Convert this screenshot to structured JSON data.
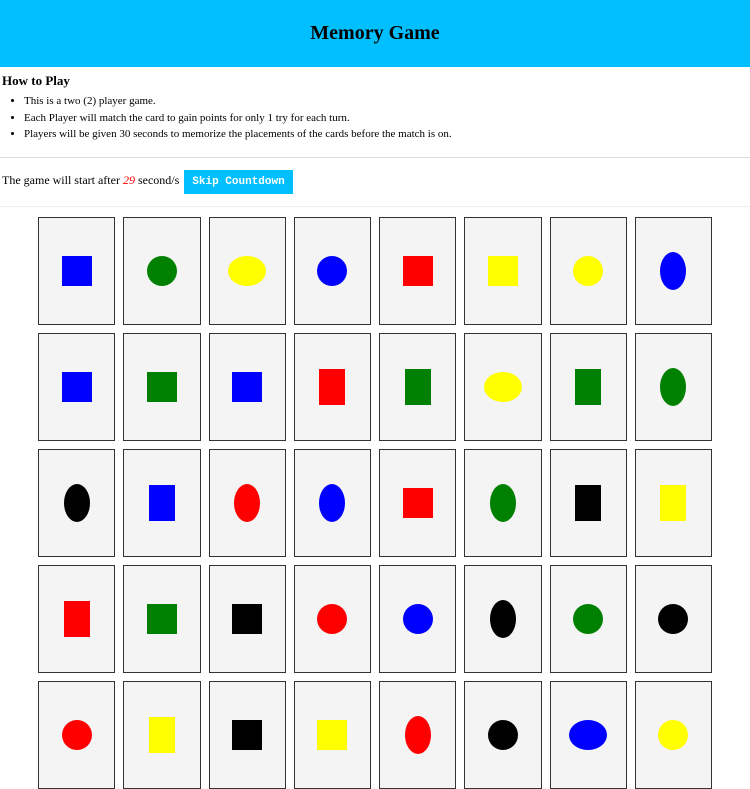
{
  "header": {
    "title": "Memory Game"
  },
  "howto": {
    "heading": "How to Play",
    "items": [
      "This is a two (2) player game.",
      "Each Player will match the card to gain points for only 1 try for each turn.",
      "Players will be given 30 seconds to memorize the placements of the cards before the match is on."
    ]
  },
  "countdown": {
    "prefix": "The game will start after ",
    "value": "29",
    "suffix": " second/s ",
    "skip_label": "Skip Countdown"
  },
  "colors": {
    "blue": "#0000ff",
    "green": "#008000",
    "yellow": "#ffff00",
    "red": "#ff0000",
    "black": "#000000"
  },
  "cards": [
    [
      {
        "shape": "square",
        "color": "blue"
      },
      {
        "shape": "circle",
        "color": "green"
      },
      {
        "shape": "ellipse-h",
        "color": "yellow"
      },
      {
        "shape": "circle",
        "color": "blue"
      },
      {
        "shape": "square",
        "color": "red"
      },
      {
        "shape": "square",
        "color": "yellow"
      },
      {
        "shape": "circle",
        "color": "yellow"
      },
      {
        "shape": "ellipse-v",
        "color": "blue"
      }
    ],
    [
      {
        "shape": "square",
        "color": "blue"
      },
      {
        "shape": "square",
        "color": "green"
      },
      {
        "shape": "square",
        "color": "blue"
      },
      {
        "shape": "rect-v",
        "color": "red"
      },
      {
        "shape": "rect-v",
        "color": "green"
      },
      {
        "shape": "ellipse-h",
        "color": "yellow"
      },
      {
        "shape": "rect-v",
        "color": "green"
      },
      {
        "shape": "ellipse-v",
        "color": "green"
      }
    ],
    [
      {
        "shape": "ellipse-v",
        "color": "black"
      },
      {
        "shape": "rect-v",
        "color": "blue"
      },
      {
        "shape": "ellipse-v",
        "color": "red"
      },
      {
        "shape": "ellipse-v",
        "color": "blue"
      },
      {
        "shape": "square",
        "color": "red"
      },
      {
        "shape": "ellipse-v",
        "color": "green"
      },
      {
        "shape": "rect-v",
        "color": "black"
      },
      {
        "shape": "rect-v",
        "color": "yellow"
      }
    ],
    [
      {
        "shape": "rect-v",
        "color": "red"
      },
      {
        "shape": "square",
        "color": "green"
      },
      {
        "shape": "square",
        "color": "black"
      },
      {
        "shape": "circle",
        "color": "red"
      },
      {
        "shape": "circle",
        "color": "blue"
      },
      {
        "shape": "ellipse-v",
        "color": "black"
      },
      {
        "shape": "circle",
        "color": "green"
      },
      {
        "shape": "circle",
        "color": "black"
      }
    ],
    [
      {
        "shape": "circle",
        "color": "red"
      },
      {
        "shape": "rect-v",
        "color": "yellow"
      },
      {
        "shape": "square",
        "color": "black"
      },
      {
        "shape": "square",
        "color": "yellow"
      },
      {
        "shape": "ellipse-v",
        "color": "red"
      },
      {
        "shape": "circle",
        "color": "black"
      },
      {
        "shape": "ellipse-h",
        "color": "blue"
      },
      {
        "shape": "circle",
        "color": "yellow"
      }
    ]
  ]
}
